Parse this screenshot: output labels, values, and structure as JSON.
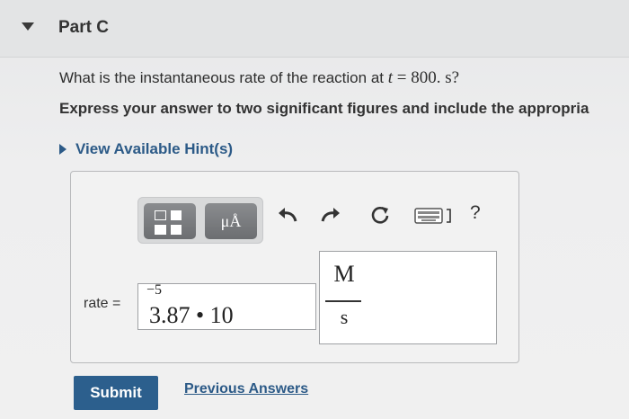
{
  "section": {
    "title": "Part C"
  },
  "question": {
    "prefix": "What is the instantaneous rate of the reaction at ",
    "variable": "t",
    "equals": " = ",
    "value": "800. s?",
    "instruction": "Express your answer to two significant figures and include the appropria"
  },
  "hint": {
    "label": "View Available Hint(s)"
  },
  "toolbar": {
    "units_label": "μÅ",
    "icons": [
      "template-icon",
      "units-icon",
      "undo-icon",
      "redo-icon",
      "reset-icon",
      "keyboard-icon",
      "help-icon"
    ],
    "help_label": "?"
  },
  "answer": {
    "label": "rate =",
    "mantissa": "3.87 • 10",
    "exponent": "−5",
    "unit_numerator": "M",
    "unit_denominator": "s"
  },
  "actions": {
    "submit_label": "Submit",
    "previous_answers_label": "Previous Answers"
  },
  "colors": {
    "link": "#2c5a87",
    "submit_bg": "#2c5f8d"
  }
}
